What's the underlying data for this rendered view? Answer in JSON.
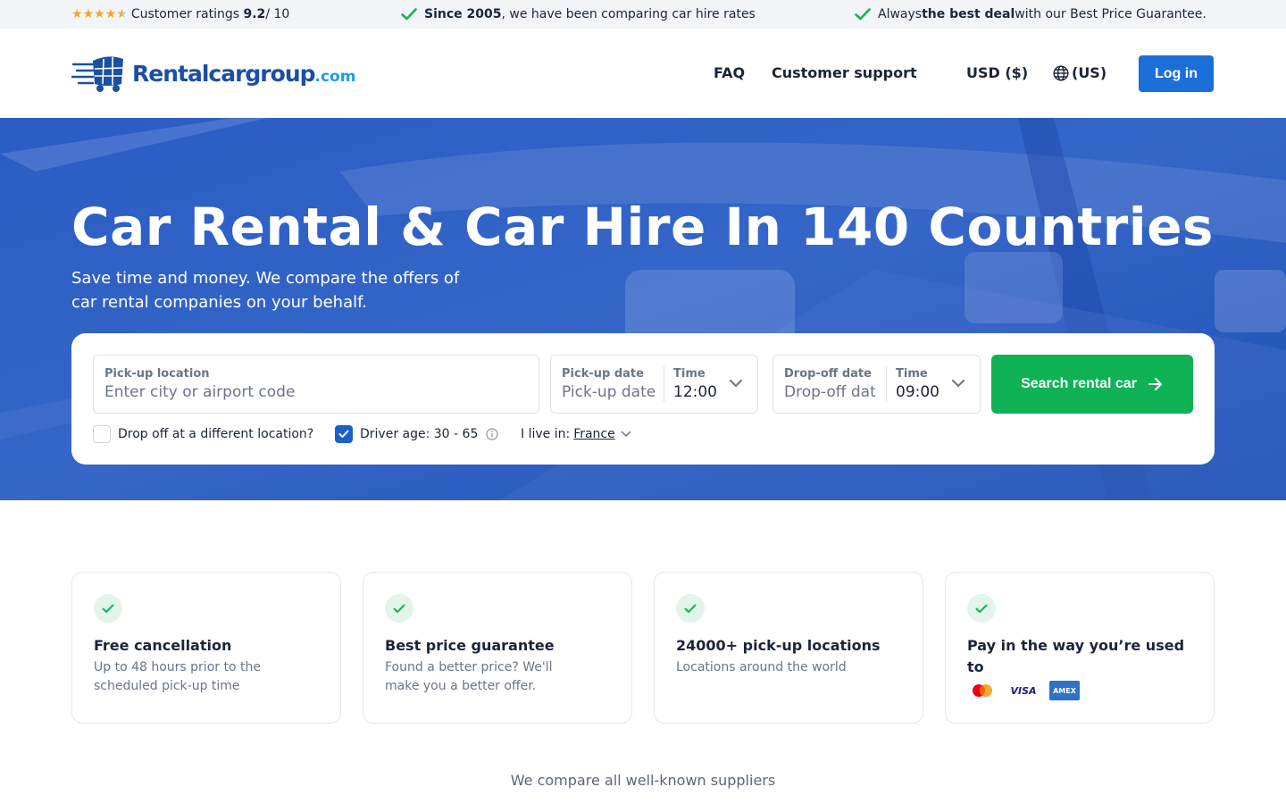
{
  "topbar": {
    "rating_prefix": "Customer ratings",
    "rating_value": "9.2",
    "rating_suffix": " / 10",
    "since_bold": "Since 2005",
    "since_rest": ", we have been comparing car hire rates",
    "deal_prefix": "Always ",
    "deal_bold": "the best deal",
    "deal_rest": " with our Best Price Guarantee."
  },
  "header": {
    "logo_main": "Rentalcargroup",
    "logo_tld": ".com",
    "faq": "FAQ",
    "support": "Customer support",
    "currency": "USD ($)",
    "language": "(US)",
    "login": "Log in"
  },
  "hero": {
    "title": "Car Rental & Car Hire In 140 Countries",
    "subtitle": "Save time and money. We compare the offers of car rental companies on your behalf."
  },
  "search": {
    "pickup_label": "Pick-up location",
    "pickup_placeholder": "Enter city or airport code",
    "pickup_date_label": "Pick-up date",
    "pickup_date_placeholder": "Pick-up date",
    "pickup_time_label": "Time",
    "pickup_time": "12:00",
    "dropoff_date_label": "Drop-off date",
    "dropoff_date_placeholder": "Drop-off date",
    "dropoff_time_label": "Time",
    "dropoff_time": "09:00",
    "search_button": "Search rental car",
    "different_location": "Drop off at a different location?",
    "different_location_checked": false,
    "driver_age": "Driver age: 30 - 65",
    "driver_age_checked": true,
    "live_in_label": "I live in:",
    "live_in_country": "France"
  },
  "features": [
    {
      "title": "Free cancellation",
      "desc": "Up to 48 hours prior to the scheduled pick-up time"
    },
    {
      "title": "Best price guarantee",
      "desc": "Found a better price? We'll make you a better offer."
    },
    {
      "title": "24000+ pick-up locations",
      "desc": "Locations around the world"
    },
    {
      "title": "Pay in the way you’re used to",
      "payment_icons": [
        "mastercard-icon",
        "visa-icon",
        "amex-icon"
      ],
      "visa_text": "VISA",
      "amex_text": "AMEX"
    }
  ],
  "compare_text": "We compare all well-known suppliers",
  "colors": {
    "brand_blue": "#1b6fd9",
    "search_green": "#0fb356",
    "hero_blue": "#2556bb",
    "star_gold": "#f5a623"
  }
}
